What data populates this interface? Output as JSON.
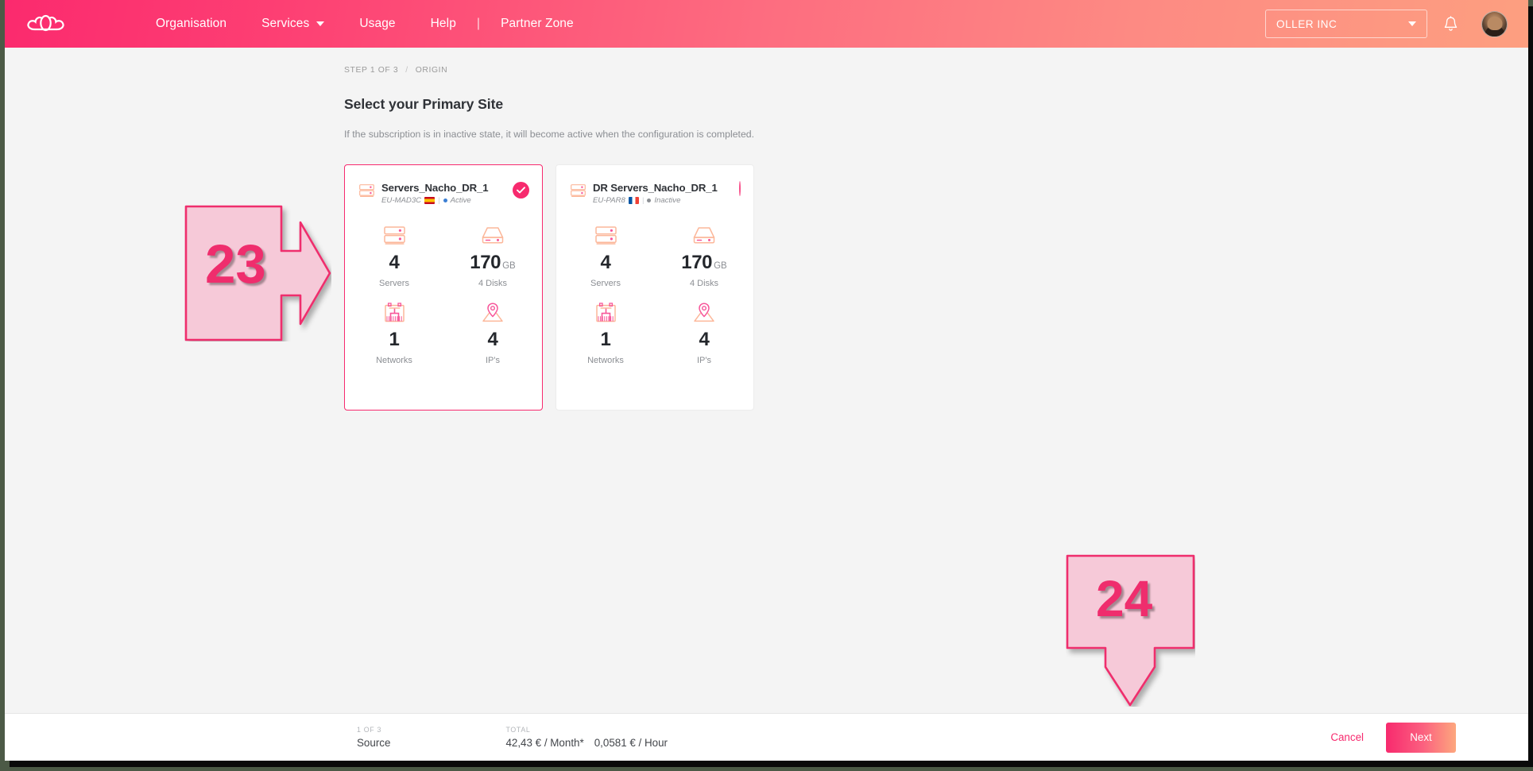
{
  "header": {
    "logo_icon": "cloud-logo",
    "nav": [
      {
        "label": "Organisation",
        "caret": false
      },
      {
        "label": "Services",
        "caret": true
      },
      {
        "label": "Usage",
        "caret": false
      },
      {
        "label": "Help",
        "caret": false
      },
      {
        "label": "|",
        "separator": true
      },
      {
        "label": "Partner Zone",
        "caret": false
      }
    ],
    "org_selector": {
      "value": "OLLER INC",
      "icon": "chevron-down-icon"
    },
    "bell_icon": "notification-bell-icon",
    "avatar": "user-avatar",
    "gradient_from": "#fb2a6e",
    "gradient_to": "#fd9f80"
  },
  "breadcrumb": {
    "step": "STEP 1 OF 3",
    "sep": "/",
    "current": "ORIGIN"
  },
  "page": {
    "title": "Select your Primary Site",
    "subtitle": "If the subscription is in inactive state, it will become active when the configuration is completed."
  },
  "cards": [
    {
      "name": "Servers_Nacho_DR_1",
      "region": "EU-MAD3C",
      "flag": "es",
      "status": "Active",
      "status_color": "#3b7fd4",
      "selected": true,
      "stats": [
        {
          "icon": "server-rack-icon",
          "value": "4",
          "unit": "",
          "label": "Servers"
        },
        {
          "icon": "disk-icon",
          "value": "170",
          "unit": "GB",
          "label": "4 Disks"
        },
        {
          "icon": "network-icon",
          "value": "1",
          "unit": "",
          "label": "Networks"
        },
        {
          "icon": "location-pin-icon",
          "value": "4",
          "unit": "",
          "label": "IP's"
        }
      ]
    },
    {
      "name": "DR Servers_Nacho_DR_1",
      "region": "EU-PAR8",
      "flag": "fr",
      "status": "Inactive",
      "status_color": "#8b8e93",
      "selected": false,
      "stats": [
        {
          "icon": "server-rack-icon",
          "value": "4",
          "unit": "",
          "label": "Servers"
        },
        {
          "icon": "disk-icon",
          "value": "170",
          "unit": "GB",
          "label": "4 Disks"
        },
        {
          "icon": "network-icon",
          "value": "1",
          "unit": "",
          "label": "Networks"
        },
        {
          "icon": "location-pin-icon",
          "value": "4",
          "unit": "",
          "label": "IP's"
        }
      ]
    }
  ],
  "footer": {
    "step_caption": "1 OF 3",
    "step_value": "Source",
    "total_caption": "TOTAL",
    "total_month": "42,43 € / Month*",
    "total_hour": "0,0581 € / Hour",
    "cancel_label": "Cancel",
    "next_label": "Next"
  },
  "annotations": [
    {
      "number": "23",
      "direction": "right"
    },
    {
      "number": "24",
      "direction": "down"
    }
  ],
  "accent": "#f72a6e"
}
